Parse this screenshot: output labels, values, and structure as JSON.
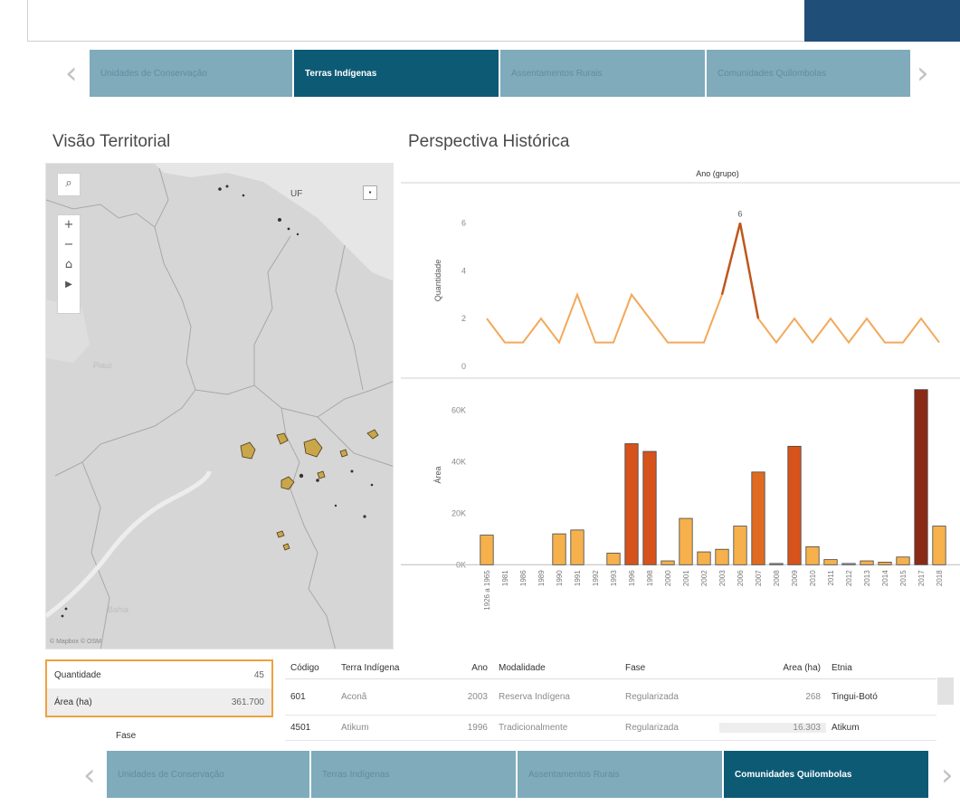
{
  "nav_top": {
    "tabs": [
      {
        "label": "Unidades de Conservação",
        "active": false
      },
      {
        "label": "Terras Indígenas",
        "active": true
      },
      {
        "label": "Assentamentos Rurais",
        "active": false
      },
      {
        "label": "Comunidades Quilombolas",
        "active": false
      }
    ],
    "prev": "‹",
    "next": "›"
  },
  "nav_bottom": {
    "tabs": [
      {
        "label": "Unidades de Conservação",
        "active": false
      },
      {
        "label": "Terras Indígenas",
        "active": false
      },
      {
        "label": "Assentamentos Rurais",
        "active": false
      },
      {
        "label": "Comunidades Quilombolas",
        "active": true
      }
    ],
    "prev": "‹",
    "next": "›"
  },
  "sections": {
    "map_title": "Visão Territorial",
    "chart_title": "Perspectiva Histórica"
  },
  "map": {
    "uf_label": "UF",
    "regions": [
      "Piauí",
      "Bahia"
    ],
    "attribution": "© Mapbox © OSM",
    "controls": [
      "search-icon",
      "zoom-in-icon",
      "zoom-out-icon",
      "home-icon",
      "play-icon"
    ],
    "colors": {
      "land": "#d9d9d9",
      "feature": "#c9a64a"
    }
  },
  "chart_data": [
    {
      "type": "line",
      "title": "Ano (grupo)",
      "ylabel": "Quantidade",
      "ylim": [
        0,
        7
      ],
      "yticks": [
        0,
        2,
        4,
        6
      ],
      "x": [
        "1926 a 1965",
        "1981",
        "1986",
        "1989",
        "1990",
        "1991",
        "1992",
        "1993",
        "1996",
        "1998",
        "2000",
        "2001",
        "2002",
        "2003",
        "2006",
        "2007",
        "2008",
        "2009",
        "2010",
        "2011",
        "2012",
        "2013",
        "2014",
        "2015",
        "2017",
        "2018"
      ],
      "values": [
        2,
        1,
        1,
        2,
        1,
        3,
        1,
        1,
        3,
        2,
        1,
        1,
        1,
        3,
        6,
        2,
        1,
        2,
        1,
        2,
        1,
        2,
        1,
        1,
        2,
        1
      ],
      "annotation": {
        "x": "2006",
        "label": "6"
      },
      "color": "#f4a85a"
    },
    {
      "type": "bar",
      "ylabel": "Área",
      "ylim": [
        -2000,
        70000
      ],
      "yticks": [
        0,
        20000,
        40000,
        60000
      ],
      "ytick_labels": [
        "0K",
        "20K",
        "40K",
        "60K"
      ],
      "categories": [
        "1926 a 1965",
        "1981",
        "1986",
        "1989",
        "1990",
        "1991",
        "1992",
        "1993",
        "1996",
        "1998",
        "2000",
        "2001",
        "2002",
        "2003",
        "2006",
        "2007",
        "2008",
        "2009",
        "2010",
        "2011",
        "2012",
        "2013",
        "2014",
        "2015",
        "2017",
        "2018"
      ],
      "values": [
        11500,
        0,
        0,
        0,
        12000,
        13500,
        0,
        4500,
        47000,
        44000,
        1500,
        18000,
        5000,
        6000,
        15000,
        36000,
        500,
        46000,
        7000,
        2000,
        500,
        1500,
        1000,
        3000,
        68000,
        15000
      ],
      "colors": [
        "#f6b14d",
        "#f6b14d",
        "#f6b14d",
        "#f6b14d",
        "#f6b14d",
        "#f6b14d",
        "#f6b14d",
        "#f6b14d",
        "#d6531c",
        "#d6531c",
        "#f6b14d",
        "#f6b14d",
        "#f6b14d",
        "#f6b14d",
        "#f6b14d",
        "#e06b20",
        "#9e9e9e",
        "#d6531c",
        "#f6b14d",
        "#f6b14d",
        "#9eb6d6",
        "#f6b14d",
        "#f6b14d",
        "#f6b14d",
        "#8b2a17",
        "#f6b14d"
      ]
    }
  ],
  "summary": {
    "rows": [
      {
        "label": "Quantidade",
        "value": "45"
      },
      {
        "label": "Área (ha)",
        "value": "361.700"
      }
    ],
    "fase_label": "Fase"
  },
  "table": {
    "headers": {
      "codigo": "Código",
      "terra": "Terra Indígena",
      "ano": "Ano",
      "modalidade": "Modalidade",
      "fase": "Fase",
      "area": "Área (ha)",
      "etnia": "Etnia"
    },
    "rows": [
      {
        "codigo": "601",
        "terra": "Aconã",
        "ano": "2003",
        "modalidade": "Reserva Indígena",
        "fase": "Regularizada",
        "area": "268",
        "etnia": "Tingui-Botó"
      },
      {
        "codigo": "4501",
        "terra": "Atikum",
        "ano": "1996",
        "modalidade": "Tradicionalmente",
        "fase": "Regularizada",
        "area": "16.303",
        "etnia": "Atikum"
      }
    ]
  }
}
